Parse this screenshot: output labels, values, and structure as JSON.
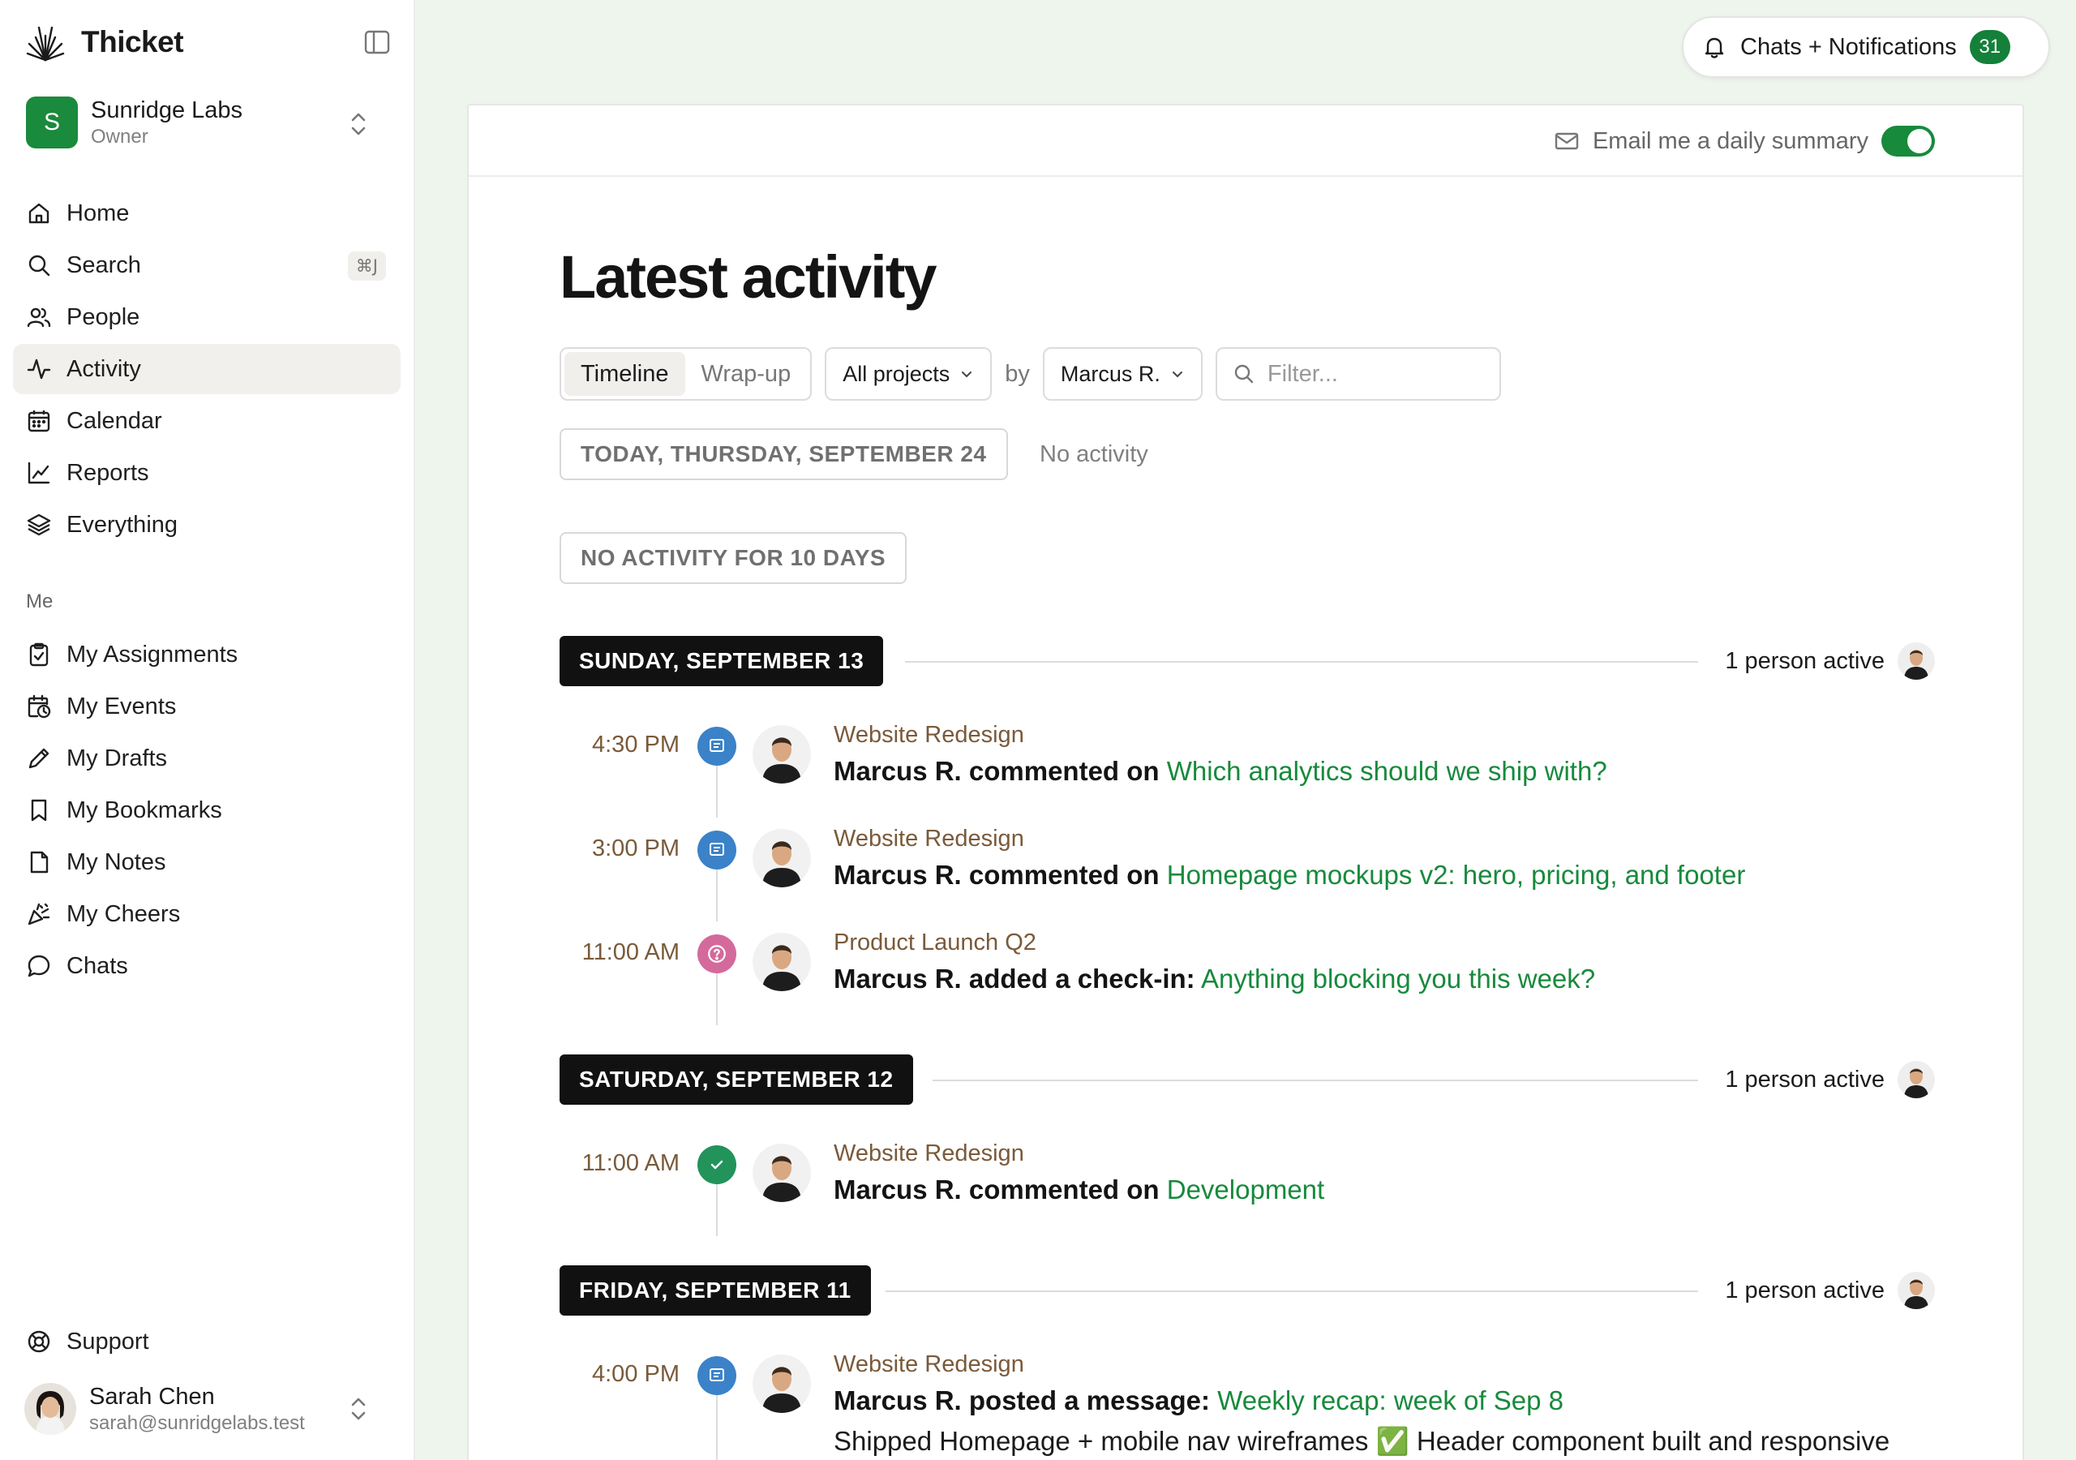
{
  "sidebar": {
    "brand": "Thicket",
    "org": {
      "initial": "S",
      "name": "Sunridge Labs",
      "role": "Owner"
    },
    "nav": [
      {
        "label": "Home",
        "icon": "home-icon"
      },
      {
        "label": "Search",
        "icon": "search-icon",
        "shortcut": "⌘J"
      },
      {
        "label": "People",
        "icon": "people-icon"
      },
      {
        "label": "Activity",
        "icon": "activity-icon",
        "active": true
      },
      {
        "label": "Calendar",
        "icon": "calendar-icon"
      },
      {
        "label": "Reports",
        "icon": "reports-icon"
      },
      {
        "label": "Everything",
        "icon": "layers-icon"
      }
    ],
    "me_label": "Me",
    "me_nav": [
      {
        "label": "My Assignments",
        "icon": "clipboard-check-icon"
      },
      {
        "label": "My Events",
        "icon": "calendar-clock-icon"
      },
      {
        "label": "My Drafts",
        "icon": "pencil-icon"
      },
      {
        "label": "My Bookmarks",
        "icon": "bookmark-icon"
      },
      {
        "label": "My Notes",
        "icon": "note-icon"
      },
      {
        "label": "My Cheers",
        "icon": "party-popper-icon"
      },
      {
        "label": "Chats",
        "icon": "chat-bubble-icon"
      }
    ],
    "support": "Support",
    "user": {
      "name": "Sarah Chen",
      "email": "sarah@sunridgelabs.test"
    }
  },
  "notifications": {
    "label": "Chats + Notifications",
    "count": "31"
  },
  "email_summary": {
    "label": "Email me a daily summary",
    "enabled": true
  },
  "page_title": "Latest activity",
  "filters": {
    "view_tabs": [
      "Timeline",
      "Wrap-up"
    ],
    "active_tab": "Timeline",
    "project": "All projects",
    "by_label": "by",
    "person": "Marcus R.",
    "filter_placeholder": "Filter..."
  },
  "today": {
    "label": "TODAY, THURSDAY, SEPTEMBER 24",
    "status": "No activity"
  },
  "gap_label": "NO ACTIVITY FOR 10 DAYS",
  "days": [
    {
      "label": "SUNDAY, SEPTEMBER 13",
      "active": "1 person active",
      "events": [
        {
          "time": "4:30 PM",
          "type": "comment",
          "badge_color": "#3b82c9",
          "project": "Website Redesign",
          "actor": "Marcus R. commented on",
          "link": "Which analytics should we ship with?"
        },
        {
          "time": "3:00 PM",
          "type": "comment",
          "badge_color": "#3b82c9",
          "project": "Website Redesign",
          "actor": "Marcus R. commented on",
          "link": "Homepage mockups v2: hero, pricing, and footer"
        },
        {
          "time": "11:00 AM",
          "type": "check-in",
          "badge_color": "#d46a9c",
          "project": "Product Launch Q2",
          "actor": "Marcus R. added a check-in:",
          "link": "Anything blocking you this week?"
        }
      ]
    },
    {
      "label": "SATURDAY, SEPTEMBER 12",
      "active": "1 person active",
      "events": [
        {
          "time": "11:00 AM",
          "type": "todo",
          "badge_color": "#22935a",
          "project": "Website Redesign",
          "actor": "Marcus R. commented on",
          "link": "Development"
        }
      ]
    },
    {
      "label": "FRIDAY, SEPTEMBER 11",
      "active": "1 person active",
      "events": [
        {
          "time": "4:00 PM",
          "type": "message",
          "badge_color": "#3b82c9",
          "project": "Website Redesign",
          "actor": "Marcus R. posted a message:",
          "link": "Weekly recap: week of Sep 8",
          "body": "Shipped Homepage + mobile nav wireframes ✅ Header component built and responsive"
        }
      ]
    }
  ],
  "colors": {
    "accent": "#178a3c",
    "brand_green": "#1a8a3c",
    "day_tag_bg": "#111111",
    "page_bg": "#eef5ec"
  }
}
